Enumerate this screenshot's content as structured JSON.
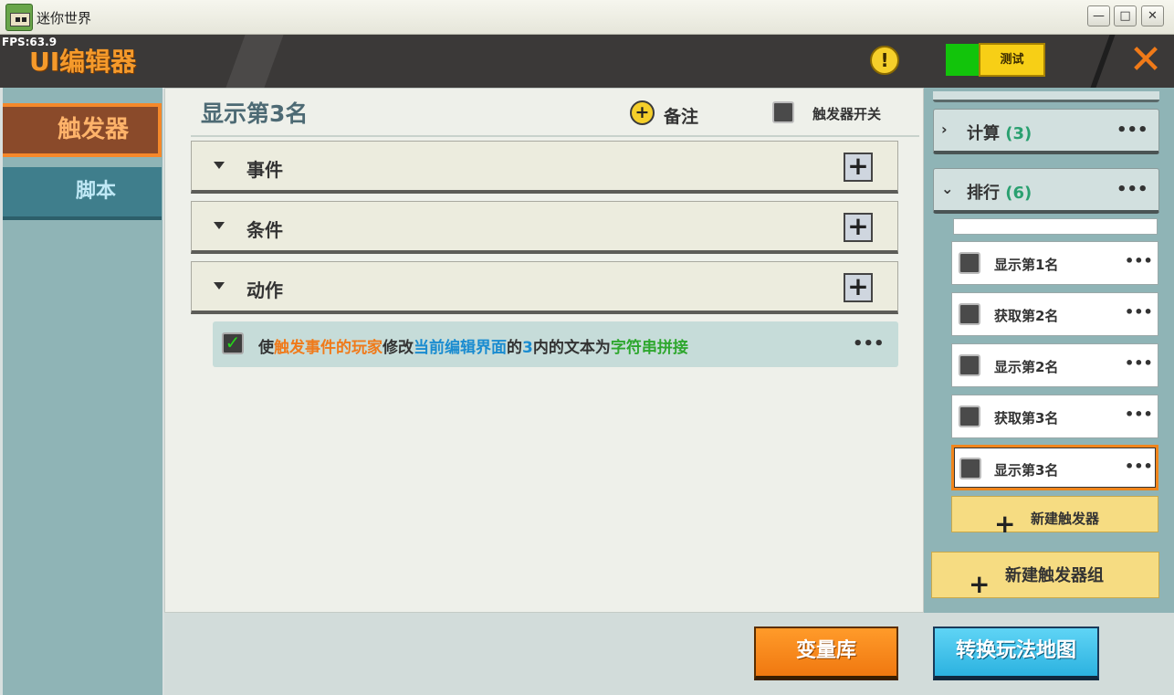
{
  "window": {
    "title": "迷你世界",
    "minimize": "—",
    "maximize": "□",
    "close": "✕"
  },
  "header": {
    "fps": "FPS:63.9",
    "title": "UI编辑器",
    "warning": "!",
    "test_label": "测试",
    "close": "✕"
  },
  "nav": {
    "trigger": "触发器",
    "script": "脚本"
  },
  "main": {
    "trigger_name": "显示第3名",
    "note_icon": "+",
    "note_label": "备注",
    "switch_label": "触发器开关",
    "sections": [
      {
        "label": "事件"
      },
      {
        "label": "条件"
      },
      {
        "label": "动作"
      }
    ],
    "plus": "+",
    "action": {
      "check": "✓",
      "p1": "使",
      "p2": "触发事件的玩家",
      "p3": "修改",
      "p4": "当前编辑界面",
      "p5": "的",
      "p6": "3",
      "p7": "内的文本为",
      "p8": "字符串拼接",
      "more": "•••"
    }
  },
  "right": {
    "groups": [
      {
        "chevron": "›",
        "label": "计算",
        "count": "(3)",
        "more": "•••"
      },
      {
        "chevron": "⌄",
        "label": "排行",
        "count": "(6)",
        "more": "•••"
      }
    ],
    "items": [
      {
        "label": "显示第1名",
        "more": "•••"
      },
      {
        "label": "获取第2名",
        "more": "•••"
      },
      {
        "label": "显示第2名",
        "more": "•••"
      },
      {
        "label": "获取第3名",
        "more": "•••"
      },
      {
        "label": "显示第3名",
        "more": "•••"
      }
    ],
    "new_trigger": "新建触发器",
    "new_group": "新建触发器组",
    "plus": "+"
  },
  "bottom": {
    "variables": "变量库",
    "convert": "转换玩法地图"
  }
}
